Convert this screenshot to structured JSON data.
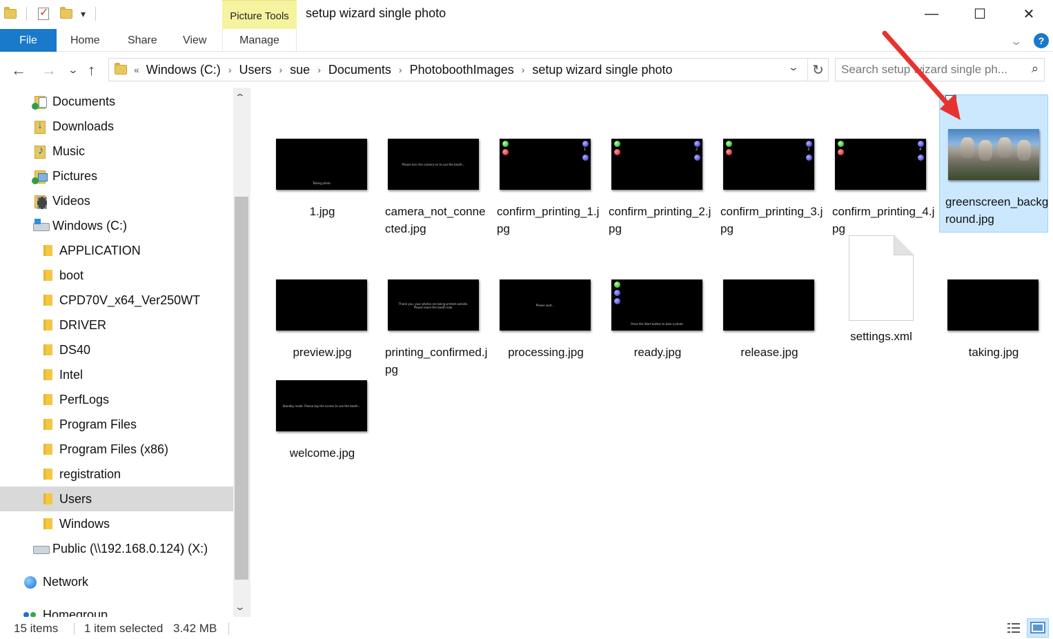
{
  "titlebar": {
    "tools_label": "Picture Tools",
    "window_title": "setup wizard single photo",
    "minimize": "—",
    "maximize": "☐",
    "close": "✕",
    "qat_dropdown": "▾"
  },
  "ribbon": {
    "file": "File",
    "tabs": [
      "Home",
      "Share",
      "View"
    ],
    "manage": "Manage",
    "expand": "⌄",
    "help": "?"
  },
  "address": {
    "back": "←",
    "forward": "→",
    "recent": "⌄",
    "up": "↑",
    "overflow": "«",
    "crumbs": [
      "Windows (C:)",
      "Users",
      "sue",
      "Documents",
      "PhotoboothImages",
      "setup wizard single photo"
    ],
    "crumb_sep": "›",
    "dropdown": "⌄",
    "refresh": "↻",
    "search_placeholder": "Search setup wizard single ph...",
    "search_icon": "⌕"
  },
  "nav_items": [
    {
      "label": "Documents",
      "icon": "documents-icon"
    },
    {
      "label": "Downloads",
      "icon": "downloads-icon"
    },
    {
      "label": "Music",
      "icon": "music-icon"
    },
    {
      "label": "Pictures",
      "icon": "pictures-icon"
    },
    {
      "label": "Videos",
      "icon": "videos-icon"
    },
    {
      "label": "Windows (C:)",
      "icon": "drive-icon"
    },
    {
      "label": "APPLICATION",
      "icon": "folder-icon"
    },
    {
      "label": "boot",
      "icon": "folder-icon"
    },
    {
      "label": "CPD70V_x64_Ver250WT",
      "icon": "folder-icon"
    },
    {
      "label": "DRIVER",
      "icon": "folder-icon"
    },
    {
      "label": "DS40",
      "icon": "folder-icon"
    },
    {
      "label": "Intel",
      "icon": "folder-icon"
    },
    {
      "label": "PerfLogs",
      "icon": "folder-icon"
    },
    {
      "label": "Program Files",
      "icon": "folder-icon"
    },
    {
      "label": "Program Files (x86)",
      "icon": "folder-icon"
    },
    {
      "label": "registration",
      "icon": "folder-icon"
    },
    {
      "label": "Users",
      "icon": "folder-icon",
      "selected": true
    },
    {
      "label": "Windows",
      "icon": "folder-icon"
    },
    {
      "label": "Public (\\\\192.168.0.124) (X:)",
      "icon": "network-drive-icon"
    },
    {
      "label": "Network",
      "icon": "network-icon"
    },
    {
      "label": "Homegroup",
      "icon": "homegroup-icon"
    }
  ],
  "scroll": {
    "up": "⌃",
    "down": "⌄"
  },
  "files": [
    {
      "name": "1.jpg",
      "thumb_text": [
        "Taking photo"
      ]
    },
    {
      "name": "camera_not_connected.jpg",
      "thumb_text": [
        "Please turn the camera on to use the booth..."
      ]
    },
    {
      "name": "confirm_printing_1.jpg",
      "dot_number": "1"
    },
    {
      "name": "confirm_printing_2.jpg",
      "dot_number": "2"
    },
    {
      "name": "confirm_printing_3.jpg",
      "dot_number": "3"
    },
    {
      "name": "confirm_printing_4.jpg",
      "dot_number": "4"
    },
    {
      "name": "greenscreen_background.jpg",
      "selected": true
    },
    {
      "name": "preview.jpg"
    },
    {
      "name": "printing_confirmed.jpg",
      "thumb_text": [
        "Thank you, your photos are being printed outside.",
        "Please leave the booth now."
      ]
    },
    {
      "name": "processing.jpg",
      "thumb_text": [
        "Please wait..."
      ]
    },
    {
      "name": "ready.jpg",
      "thumb_text": [
        "Press the Start button to take a photo"
      ]
    },
    {
      "name": "release.jpg"
    },
    {
      "name": "settings.xml"
    },
    {
      "name": "taking.jpg"
    },
    {
      "name": "welcome.jpg",
      "thumb_text": [
        "Standby mode. Please tap the screen to use the booth..."
      ]
    }
  ],
  "status": {
    "items": "15 items",
    "selected": "1 item selected",
    "size": "3.42 MB"
  },
  "colors": {
    "file_tab": "#1979ca",
    "selection": "#cce8ff",
    "tools_tab": "#f6f3a0",
    "annotation_arrow": "#e8322e"
  }
}
